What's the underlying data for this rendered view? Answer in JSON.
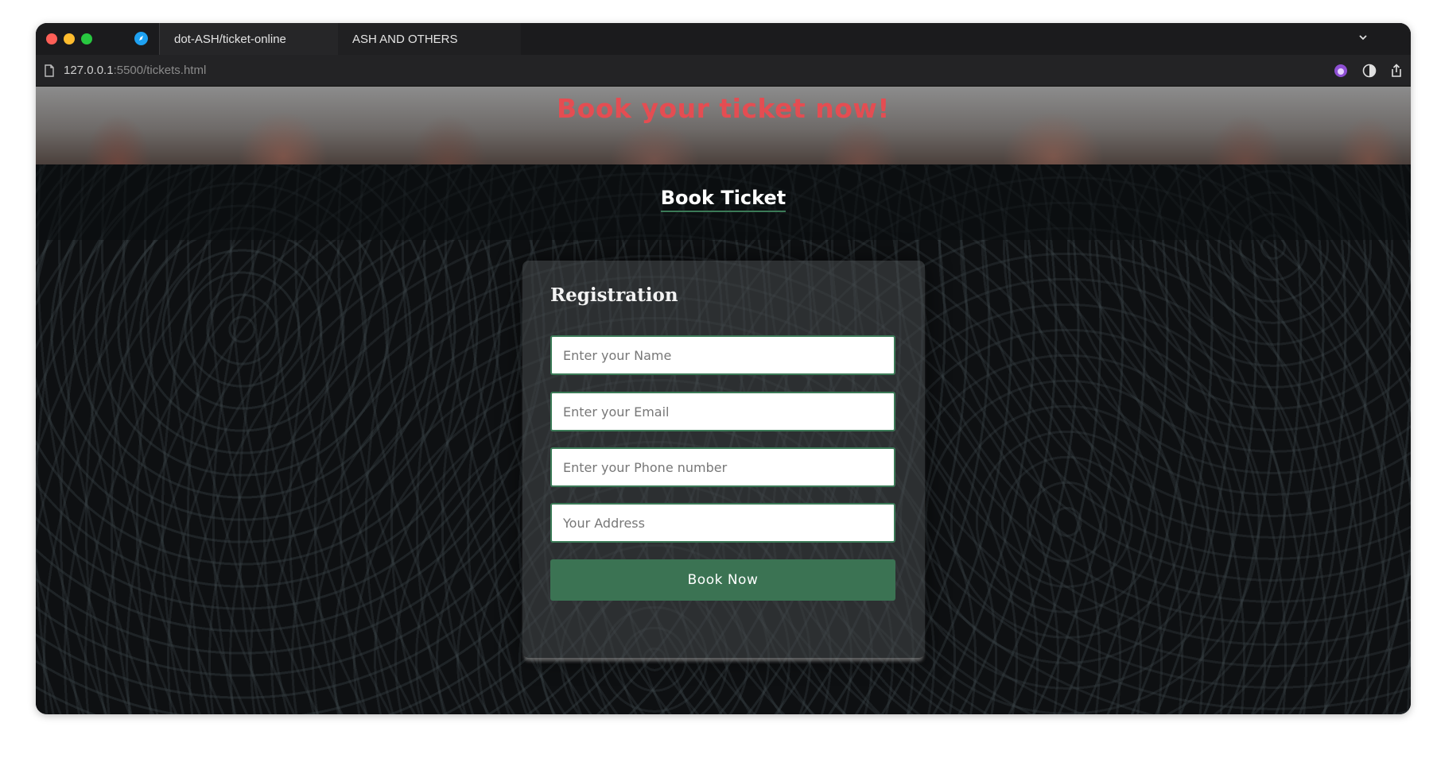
{
  "browser": {
    "tabs": [
      {
        "label": "dot-ASH/ticket-online",
        "active": true
      },
      {
        "label": "ASH AND OTHERS",
        "active": false
      }
    ],
    "url_host": "127.0.0.1",
    "url_path": ":5500/tickets.html",
    "icons": [
      "compass-icon",
      "chevron-down-icon",
      "page-icon",
      "extension-icon",
      "privacy-icon",
      "share-icon"
    ]
  },
  "hero": {
    "title": "Book your ticket now!"
  },
  "section": {
    "title": "Book Ticket"
  },
  "form": {
    "title": "Registration",
    "name_placeholder": "Enter your Name",
    "email_placeholder": "Enter your Email",
    "phone_placeholder": "Enter your Phone number",
    "address_placeholder": "Your Address",
    "submit_label": "Book Now"
  },
  "colors": {
    "accent": "#3b7353",
    "hero_title": "#e44d52",
    "background": "#0e1012"
  }
}
